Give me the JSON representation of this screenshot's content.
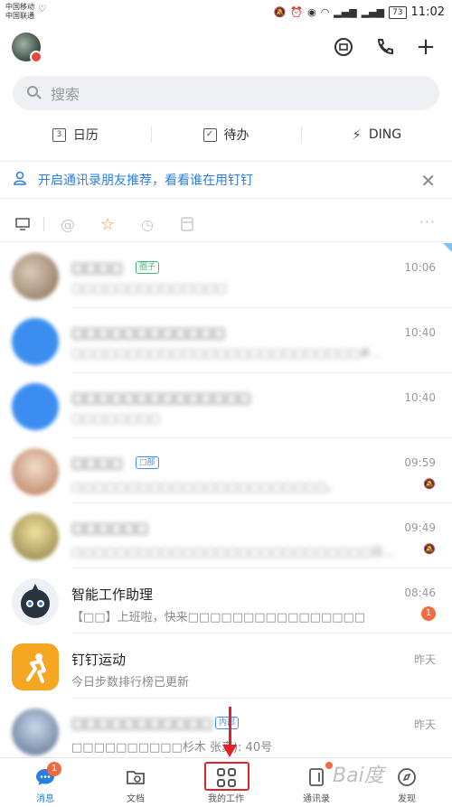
{
  "status_bar": {
    "carrier_1": "中国移动",
    "carrier_2": "中国联通",
    "battery": "73",
    "time": "11:02"
  },
  "search": {
    "placeholder": "搜索"
  },
  "quick_actions": [
    {
      "label": "日历",
      "icon": "calendar-icon",
      "icon_text": "3"
    },
    {
      "label": "待办",
      "icon": "todo-check-icon"
    },
    {
      "label": "DING",
      "icon": "ding-lightning-icon"
    }
  ],
  "banner": {
    "text": "开启通讯录朋友推荐，看看谁在用钉钉"
  },
  "chats": [
    {
      "name": "□□□□",
      "tag": "圈子",
      "preview": "□□□□□□□□□□□□□□",
      "time": "10:06",
      "pinned": true,
      "avatar_color": "#b9a48c"
    },
    {
      "name": "□□□□□□□□□□□□",
      "preview": "□□□□□□□□□□□□□□□□□□□□□□□□□□#…",
      "time": "10:40",
      "avatar_color": "#3b8ef0"
    },
    {
      "name": "□□□□□□□□□□□□□□",
      "preview": "□□□□□□□□",
      "time": "10:40",
      "avatar_color": "#3b8ef0"
    },
    {
      "name": "□□□□",
      "tag": "□部",
      "preview": "□□□□□□□□□□□□□□□□□□□□□□□。",
      "time": "09:59",
      "muted": true,
      "avatar_color": "#e8c4a8"
    },
    {
      "name": "□□□□□□",
      "preview": "□□□□□□□□□□□□□□□□□□□□□□□□□□□日…",
      "time": "09:49",
      "muted": true,
      "avatar_color": "#d8c06a"
    },
    {
      "name": "智能工作助理",
      "preview": "【□□】上班啦，快来□□□□□□□□□□□□□□□□",
      "time": "08:46",
      "unread": "1",
      "avatar_color": "#2a3440"
    },
    {
      "name": "钉钉运动",
      "preview": "今日步数排行榜已更新",
      "time": "昨天",
      "avatar_color": "#f5a623"
    },
    {
      "name": "□□□□□□□□□□□",
      "tag": "内部",
      "preview": "□□□□□□□□□□杉木 张真): 40号",
      "time": "昨天",
      "avatar_color": "#8aa0b8"
    }
  ],
  "tabs": [
    {
      "label": "消息",
      "active": true,
      "badge": "1"
    },
    {
      "label": "文档"
    },
    {
      "label": "我的工作"
    },
    {
      "label": "通讯录",
      "dot": true
    },
    {
      "label": "发现"
    }
  ],
  "watermark": "Bai度"
}
